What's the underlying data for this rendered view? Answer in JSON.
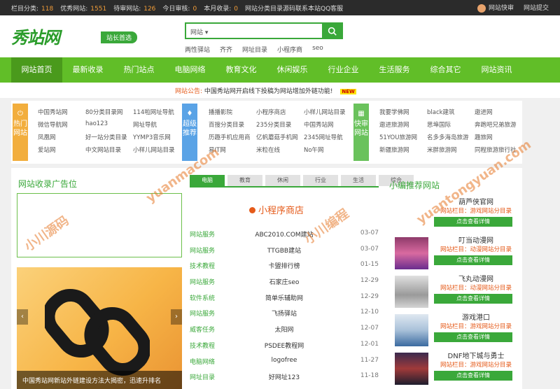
{
  "topbar": {
    "stats": [
      {
        "label": "栏目分类:",
        "value": "118"
      },
      {
        "label": "优秀网站:",
        "value": "1551"
      },
      {
        "label": "待审网站:",
        "value": "126"
      },
      {
        "label": "今日审核:",
        "value": "0"
      },
      {
        "label": "本月收录:",
        "value": "0"
      }
    ],
    "notice": "网站分类目录源码联系本站QQ客服",
    "links": [
      "网站快审",
      "网站提交"
    ]
  },
  "header": {
    "logo_text": "秀站网",
    "slogan": "站长首选",
    "search_value": "网站",
    "quick_links": [
      "两性驿站",
      "齐齐",
      "网址目录",
      "小程序商",
      "seo"
    ]
  },
  "nav": [
    "网站首页",
    "最新收录",
    "热门站点",
    "电脑网络",
    "教育文化",
    "休闲娱乐",
    "行业企业",
    "生活服务",
    "综合其它",
    "网站资讯"
  ],
  "announce": {
    "label": "网站公告:",
    "text": "中国秀站网开启线下投稿为网站增加外链功能!",
    "badge": "NEW"
  },
  "categories": [
    {
      "name": "热门网站",
      "color": "#f2ae3d",
      "links": [
        "中国秀站网",
        "80分类目录网",
        "114啦网址导航",
        "微信导航网",
        "hao123",
        "网址导航",
        "凤凰网",
        "好一站分类目录",
        "YYMP3音乐网",
        "爱站网",
        "中文网站目录",
        "小样儿网站目录"
      ]
    },
    {
      "name": "超级推荐",
      "color": "#5aa3e6",
      "links": [
        "播播影院",
        "小程序商店",
        "小样儿网站目录",
        "百搜分类目录",
        "235分类目录",
        "中国秀站网",
        "历趣手机应用商",
        "亿帆蘑菇手机网",
        "2345网址导航",
        "易IT网",
        "米粒在线",
        "No午网"
      ]
    },
    {
      "name": "快审网站",
      "color": "#6ac25c",
      "links": [
        "我要学佛网",
        "black建筑",
        "遨进网",
        "遨进旅游网",
        "思埠国际",
        "奔跑吧兄弟旅游",
        "51YOU旅游网",
        "名多多海岛旅游",
        "趣旅网",
        "新疆旅游网",
        "米胖旅游网",
        "同程旅游旅行社"
      ]
    }
  ],
  "ad": {
    "title": "网站收录广告位",
    "banner_caption": "中国秀站网新站外链建设方法大揭密，迅速升排名"
  },
  "tabs": [
    "电脑",
    "教育",
    "休闲",
    "行业",
    "生活",
    "综合"
  ],
  "section_title": "小程序商店",
  "articles": [
    {
      "cat": "网站服务",
      "title": "ABC2010.COM建站",
      "date": "03-07"
    },
    {
      "cat": "网站服务",
      "title": "TTGBB建站",
      "date": "03-07"
    },
    {
      "cat": "技术教程",
      "title": "卡盟排行榜",
      "date": "01-15"
    },
    {
      "cat": "网站服务",
      "title": "石家庄seo",
      "date": "12-29"
    },
    {
      "cat": "软件系统",
      "title": "简单乐辅助网",
      "date": "12-29"
    },
    {
      "cat": "网站服务",
      "title": "飞扬驿站",
      "date": "12-10"
    },
    {
      "cat": "威客任务",
      "title": "太阳网",
      "date": "12-07"
    },
    {
      "cat": "技术教程",
      "title": "PSDEE教程网",
      "date": "12-01"
    },
    {
      "cat": "电脑网络",
      "title": "logofree",
      "date": "11-27"
    },
    {
      "cat": "网址目录",
      "title": "好网址123",
      "date": "11-18"
    }
  ],
  "recommend": {
    "title": "小编推荐网站",
    "items": [
      {
        "name": "葫芦侠官网",
        "sub": "网站栏目：游戏网站分目录",
        "btn": "点击查看详情",
        "thumb": "#ffffff"
      },
      {
        "name": "叮当动漫网",
        "sub": "网站栏目：动漫网站分目录",
        "btn": "点击查看详情",
        "thumb": "#8e3a6a"
      },
      {
        "name": "飞丸动漫网",
        "sub": "网站栏目：动漫网站分目录",
        "btn": "点击查看详情",
        "thumb": "#c9c9c9"
      },
      {
        "name": "游戏港口",
        "sub": "网站栏目：游戏网站分目录",
        "btn": "点击查看详情",
        "thumb": "#dfe8f1"
      },
      {
        "name": "DNF地下城与勇士",
        "sub": "网站栏目：游戏网站分目录",
        "btn": "点击查看详情",
        "thumb": "#3b2a4e"
      }
    ]
  },
  "watermarks": [
    "小川源码",
    "小川编程",
    "yuanmacom",
    "yuantongyuan.com"
  ],
  "colors": {
    "green": "#61be28",
    "accent": "#e55a19"
  }
}
